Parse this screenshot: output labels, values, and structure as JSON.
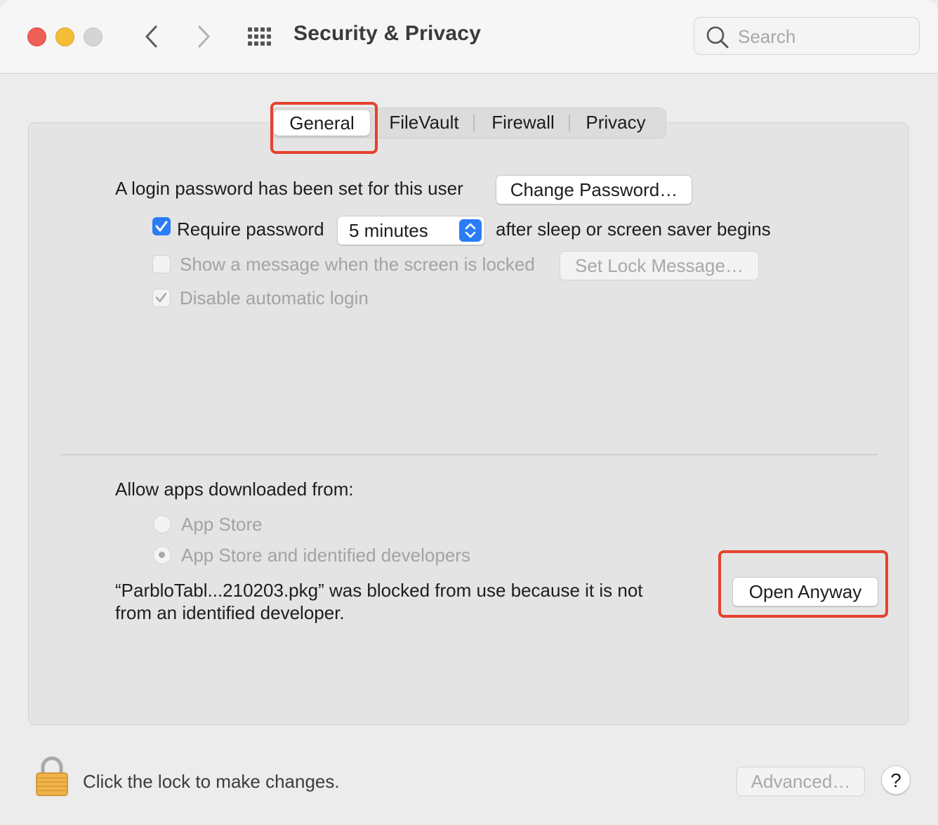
{
  "window": {
    "title": "Security & Privacy",
    "search": {
      "placeholder": "Search",
      "value": ""
    }
  },
  "tabs": [
    {
      "label": "General",
      "selected": true
    },
    {
      "label": "FileVault",
      "selected": false
    },
    {
      "label": "Firewall",
      "selected": false
    },
    {
      "label": "Privacy",
      "selected": false
    }
  ],
  "general": {
    "login_text": "A login password has been set for this user",
    "change_password_label": "Change Password…",
    "require_password": {
      "checked": true,
      "label": "Require password"
    },
    "require_interval": "5 minutes",
    "require_suffix": "after sleep or screen saver begins",
    "show_message": {
      "checked": false,
      "label": "Show a message when the screen is locked"
    },
    "set_lock_message_label": "Set Lock Message…",
    "disable_auto_login": {
      "checked": true,
      "label": "Disable automatic login"
    }
  },
  "allow_apps": {
    "heading": "Allow apps downloaded from:",
    "options": [
      {
        "label": "App Store",
        "selected": false
      },
      {
        "label": "App Store and identified developers",
        "selected": true
      }
    ],
    "blocked_message_line1": "“ParbloTabl...210203.pkg” was blocked from use because it is not",
    "blocked_message_line2": "from an identified developer.",
    "open_anyway_label": "Open Anyway"
  },
  "footer": {
    "lock_text": "Click the lock to make changes.",
    "advanced_label": "Advanced…",
    "help_label": "?"
  },
  "colors": {
    "accent": "#2b7cf6",
    "highlight": "#e5412e",
    "close": "#ee5f55",
    "minimize": "#f5bd35"
  }
}
